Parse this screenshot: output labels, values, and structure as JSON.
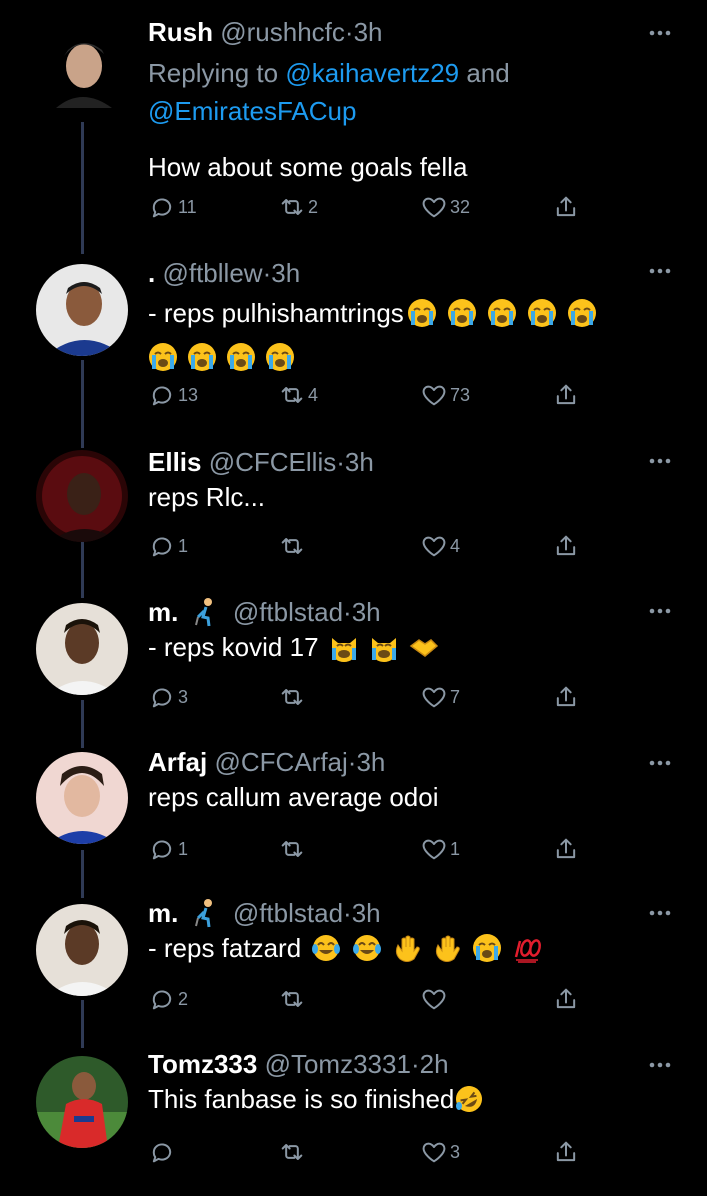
{
  "tweets": [
    {
      "name": "Rush",
      "handle": "@rushhcfc",
      "time": "3h",
      "reply_prefix": "Replying to ",
      "reply_mention_1": "@kaihavertz29",
      "reply_and": " and",
      "reply_mention_2": "@EmiratesFACup",
      "text": "How about some goals fella",
      "replies": "11",
      "retweets": "2",
      "likes": "32"
    },
    {
      "name": ".",
      "handle": "@ftbllew",
      "time": "3h",
      "text": "- reps pulhishamtrings",
      "emojis": [
        "crying",
        "crying",
        "crying",
        "crying",
        "crying",
        "crying",
        "crying",
        "crying",
        "crying"
      ],
      "replies": "13",
      "retweets": "4",
      "likes": "73"
    },
    {
      "name": "Ellis",
      "handle": "@CFCEllis",
      "time": "3h",
      "text": "reps Rlc...",
      "replies": "1",
      "retweets": "",
      "likes": "4"
    },
    {
      "name": "m.",
      "handle": "@ftblstad",
      "time": "3h",
      "text": "- reps kovid 17",
      "emojis": [
        "crying-cat",
        "crying-cat",
        "handshake"
      ],
      "replies": "3",
      "retweets": "",
      "likes": "7"
    },
    {
      "name": "Arfaj",
      "handle": "@CFCArfaj",
      "time": "3h",
      "text": "reps callum average odoi",
      "replies": "1",
      "retweets": "",
      "likes": "1"
    },
    {
      "name": "m.",
      "handle": "@ftblstad",
      "time": "3h",
      "text": "- reps fatzard",
      "emojis": [
        "tears-of-joy",
        "tears-of-joy",
        "waving-hand",
        "waving-hand",
        "crying",
        "hundred-points"
      ],
      "replies": "2",
      "retweets": "",
      "likes": ""
    },
    {
      "name": "Tomz333",
      "handle": "@Tomz3331",
      "time": "2h",
      "text": "This fanbase is so finished",
      "emojis": [
        "rolling-laughing"
      ],
      "replies": "",
      "retweets": "",
      "likes": "3"
    }
  ],
  "separator": "·",
  "icons": {
    "reply": "reply-icon",
    "retweet": "retweet-icon",
    "like": "like-icon",
    "share": "share-icon",
    "more": "more-icon"
  },
  "colors": {
    "background": "#000000",
    "text": "#ffffff",
    "muted": "#8b98a5",
    "link": "#1d9bf0",
    "thread_line": "#2f3a55"
  }
}
